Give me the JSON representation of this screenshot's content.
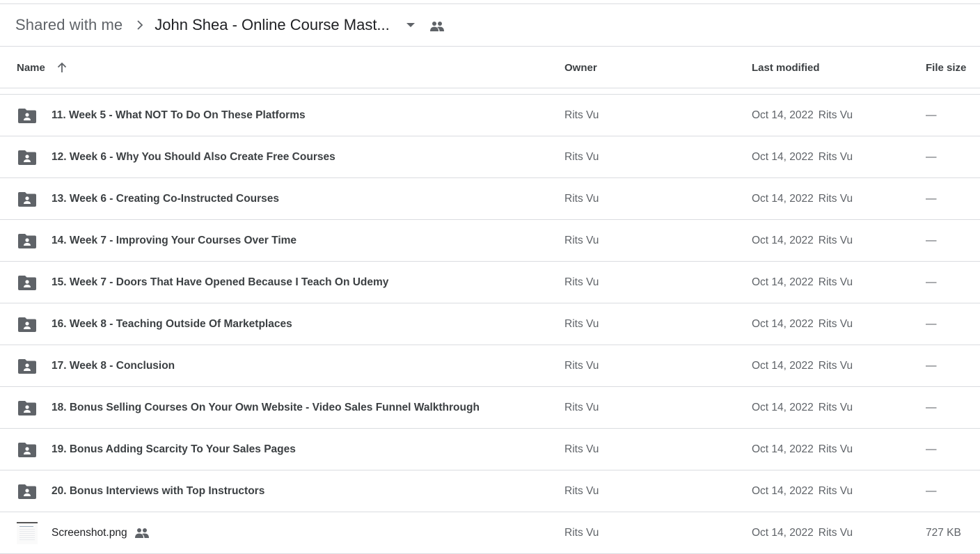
{
  "breadcrumb": {
    "root": "Shared with me",
    "current": "John Shea - Online Course Mast..."
  },
  "columns": {
    "name": "Name",
    "owner": "Owner",
    "last_modified": "Last modified",
    "file_size": "File size"
  },
  "sort": {
    "column": "Name",
    "direction": "ascending"
  },
  "rows": [
    {
      "type": "shared-folder",
      "name": "11. Week 5 - What NOT To Do On These Platforms",
      "owner": "Rits Vu",
      "modified": "Oct 14, 2022",
      "modified_by": "Rits Vu",
      "size": "—"
    },
    {
      "type": "shared-folder",
      "name": "12. Week 6 - Why You Should Also Create Free Courses",
      "owner": "Rits Vu",
      "modified": "Oct 14, 2022",
      "modified_by": "Rits Vu",
      "size": "—"
    },
    {
      "type": "shared-folder",
      "name": "13. Week 6 - Creating Co-Instructed Courses",
      "owner": "Rits Vu",
      "modified": "Oct 14, 2022",
      "modified_by": "Rits Vu",
      "size": "—"
    },
    {
      "type": "shared-folder",
      "name": "14. Week 7 - Improving Your Courses Over Time",
      "owner": "Rits Vu",
      "modified": "Oct 14, 2022",
      "modified_by": "Rits Vu",
      "size": "—"
    },
    {
      "type": "shared-folder",
      "name": "15. Week 7 - Doors That Have Opened Because I Teach On Udemy",
      "owner": "Rits Vu",
      "modified": "Oct 14, 2022",
      "modified_by": "Rits Vu",
      "size": "—"
    },
    {
      "type": "shared-folder",
      "name": "16. Week 8 - Teaching Outside Of Marketplaces",
      "owner": "Rits Vu",
      "modified": "Oct 14, 2022",
      "modified_by": "Rits Vu",
      "size": "—"
    },
    {
      "type": "shared-folder",
      "name": "17. Week 8 - Conclusion",
      "owner": "Rits Vu",
      "modified": "Oct 14, 2022",
      "modified_by": "Rits Vu",
      "size": "—"
    },
    {
      "type": "shared-folder",
      "name": "18. Bonus Selling Courses On Your Own Website - Video Sales Funnel Walkthrough",
      "owner": "Rits Vu",
      "modified": "Oct 14, 2022",
      "modified_by": "Rits Vu",
      "size": "—"
    },
    {
      "type": "shared-folder",
      "name": "19. Bonus Adding Scarcity To Your Sales Pages",
      "owner": "Rits Vu",
      "modified": "Oct 14, 2022",
      "modified_by": "Rits Vu",
      "size": "—"
    },
    {
      "type": "shared-folder",
      "name": "20. Bonus Interviews with Top Instructors",
      "owner": "Rits Vu",
      "modified": "Oct 14, 2022",
      "modified_by": "Rits Vu",
      "size": "—"
    },
    {
      "type": "image",
      "name": "Screenshot.png",
      "shared": true,
      "owner": "Rits Vu",
      "modified": "Oct 14, 2022",
      "modified_by": "Rits Vu",
      "size": "727 KB"
    }
  ],
  "colors": {
    "icon_gray": "#5f6368",
    "text_dark": "#3c4043",
    "divider": "#dadce0"
  }
}
